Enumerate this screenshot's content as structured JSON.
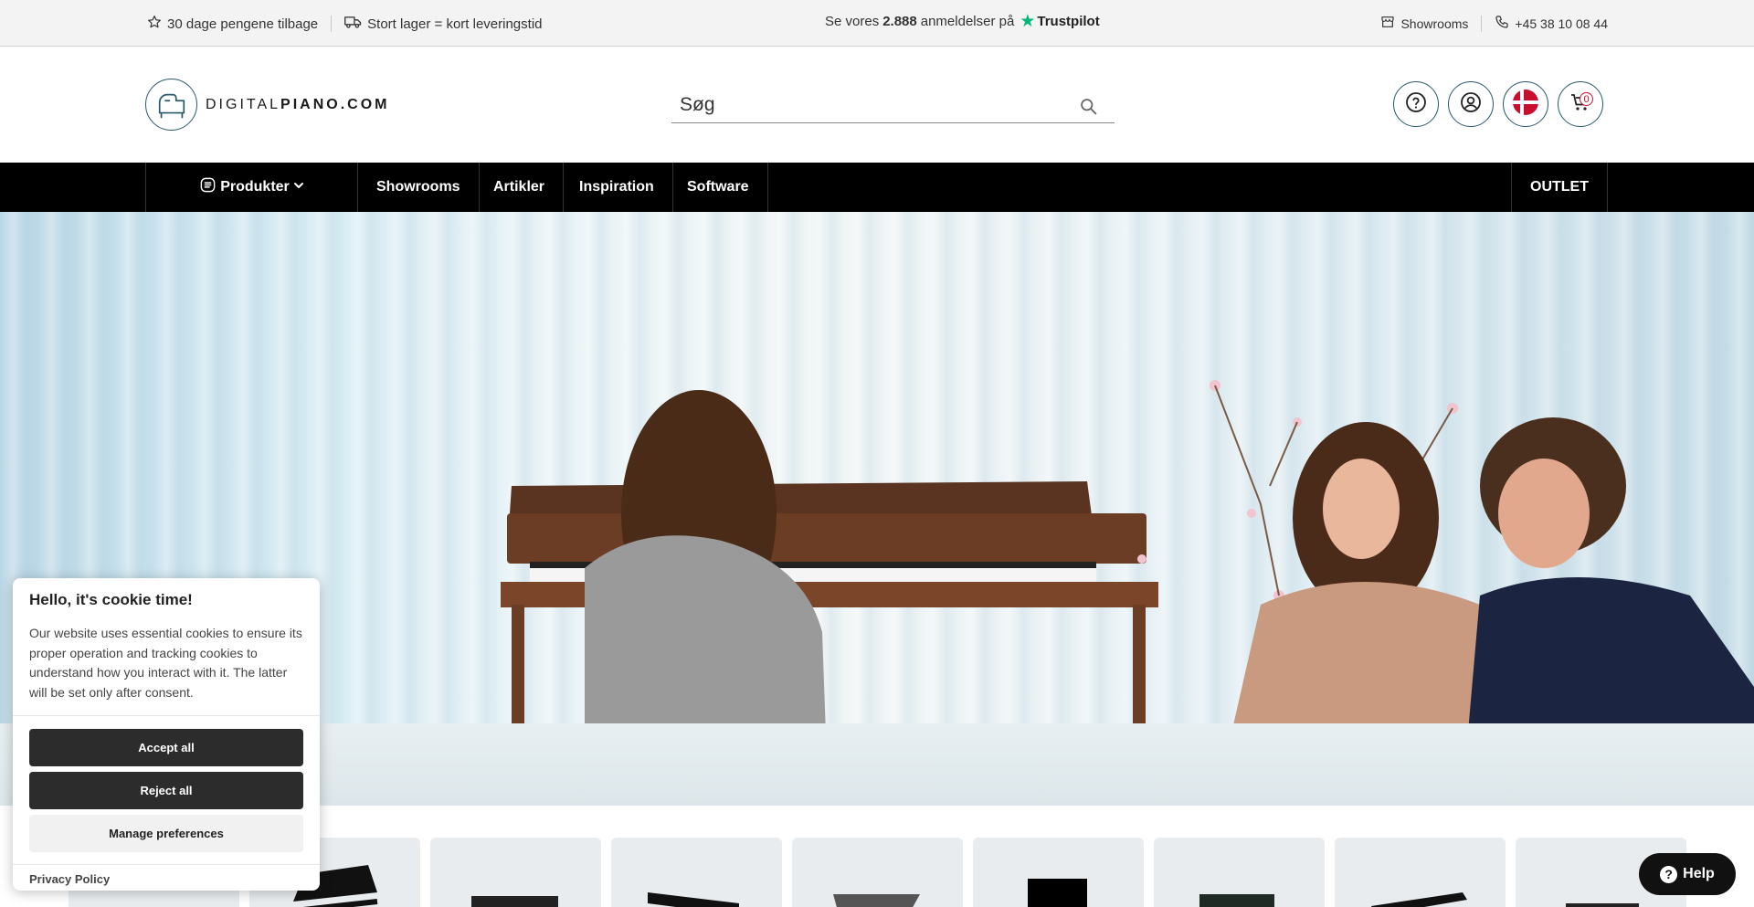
{
  "topbar": {
    "guarantee": "30 dage pengene tilbage",
    "stock": "Stort lager = kort leveringstid",
    "reviews_prefix": "Se vores",
    "reviews_count": "2.888",
    "reviews_suffix": "anmeldelser på",
    "trustpilot": "Trustpilot",
    "showrooms": "Showrooms",
    "phone": "+45 38 10 08 44"
  },
  "header": {
    "logo_light": "DIGITAL",
    "logo_bold": "PIANO.COM",
    "search_placeholder": "Søg",
    "cart_count": "0"
  },
  "nav": {
    "products": "Produkter",
    "items": [
      "Showrooms",
      "Artikler",
      "Inspiration",
      "Software"
    ],
    "outlet": "OUTLET"
  },
  "cookie": {
    "title": "Hello, it's cookie time!",
    "body": "Our website uses essential cookies to ensure its proper operation and tracking cookies to understand how you interact with it. The latter will be set only after consent.",
    "accept": "Accept all",
    "reject": "Reject all",
    "manage": "Manage preferences",
    "privacy": "Privacy Policy"
  },
  "help": {
    "label": "Help"
  },
  "colors": {
    "accent": "#2a5a6a",
    "trustpilot": "#00b67a",
    "badge": "#c8102e"
  }
}
